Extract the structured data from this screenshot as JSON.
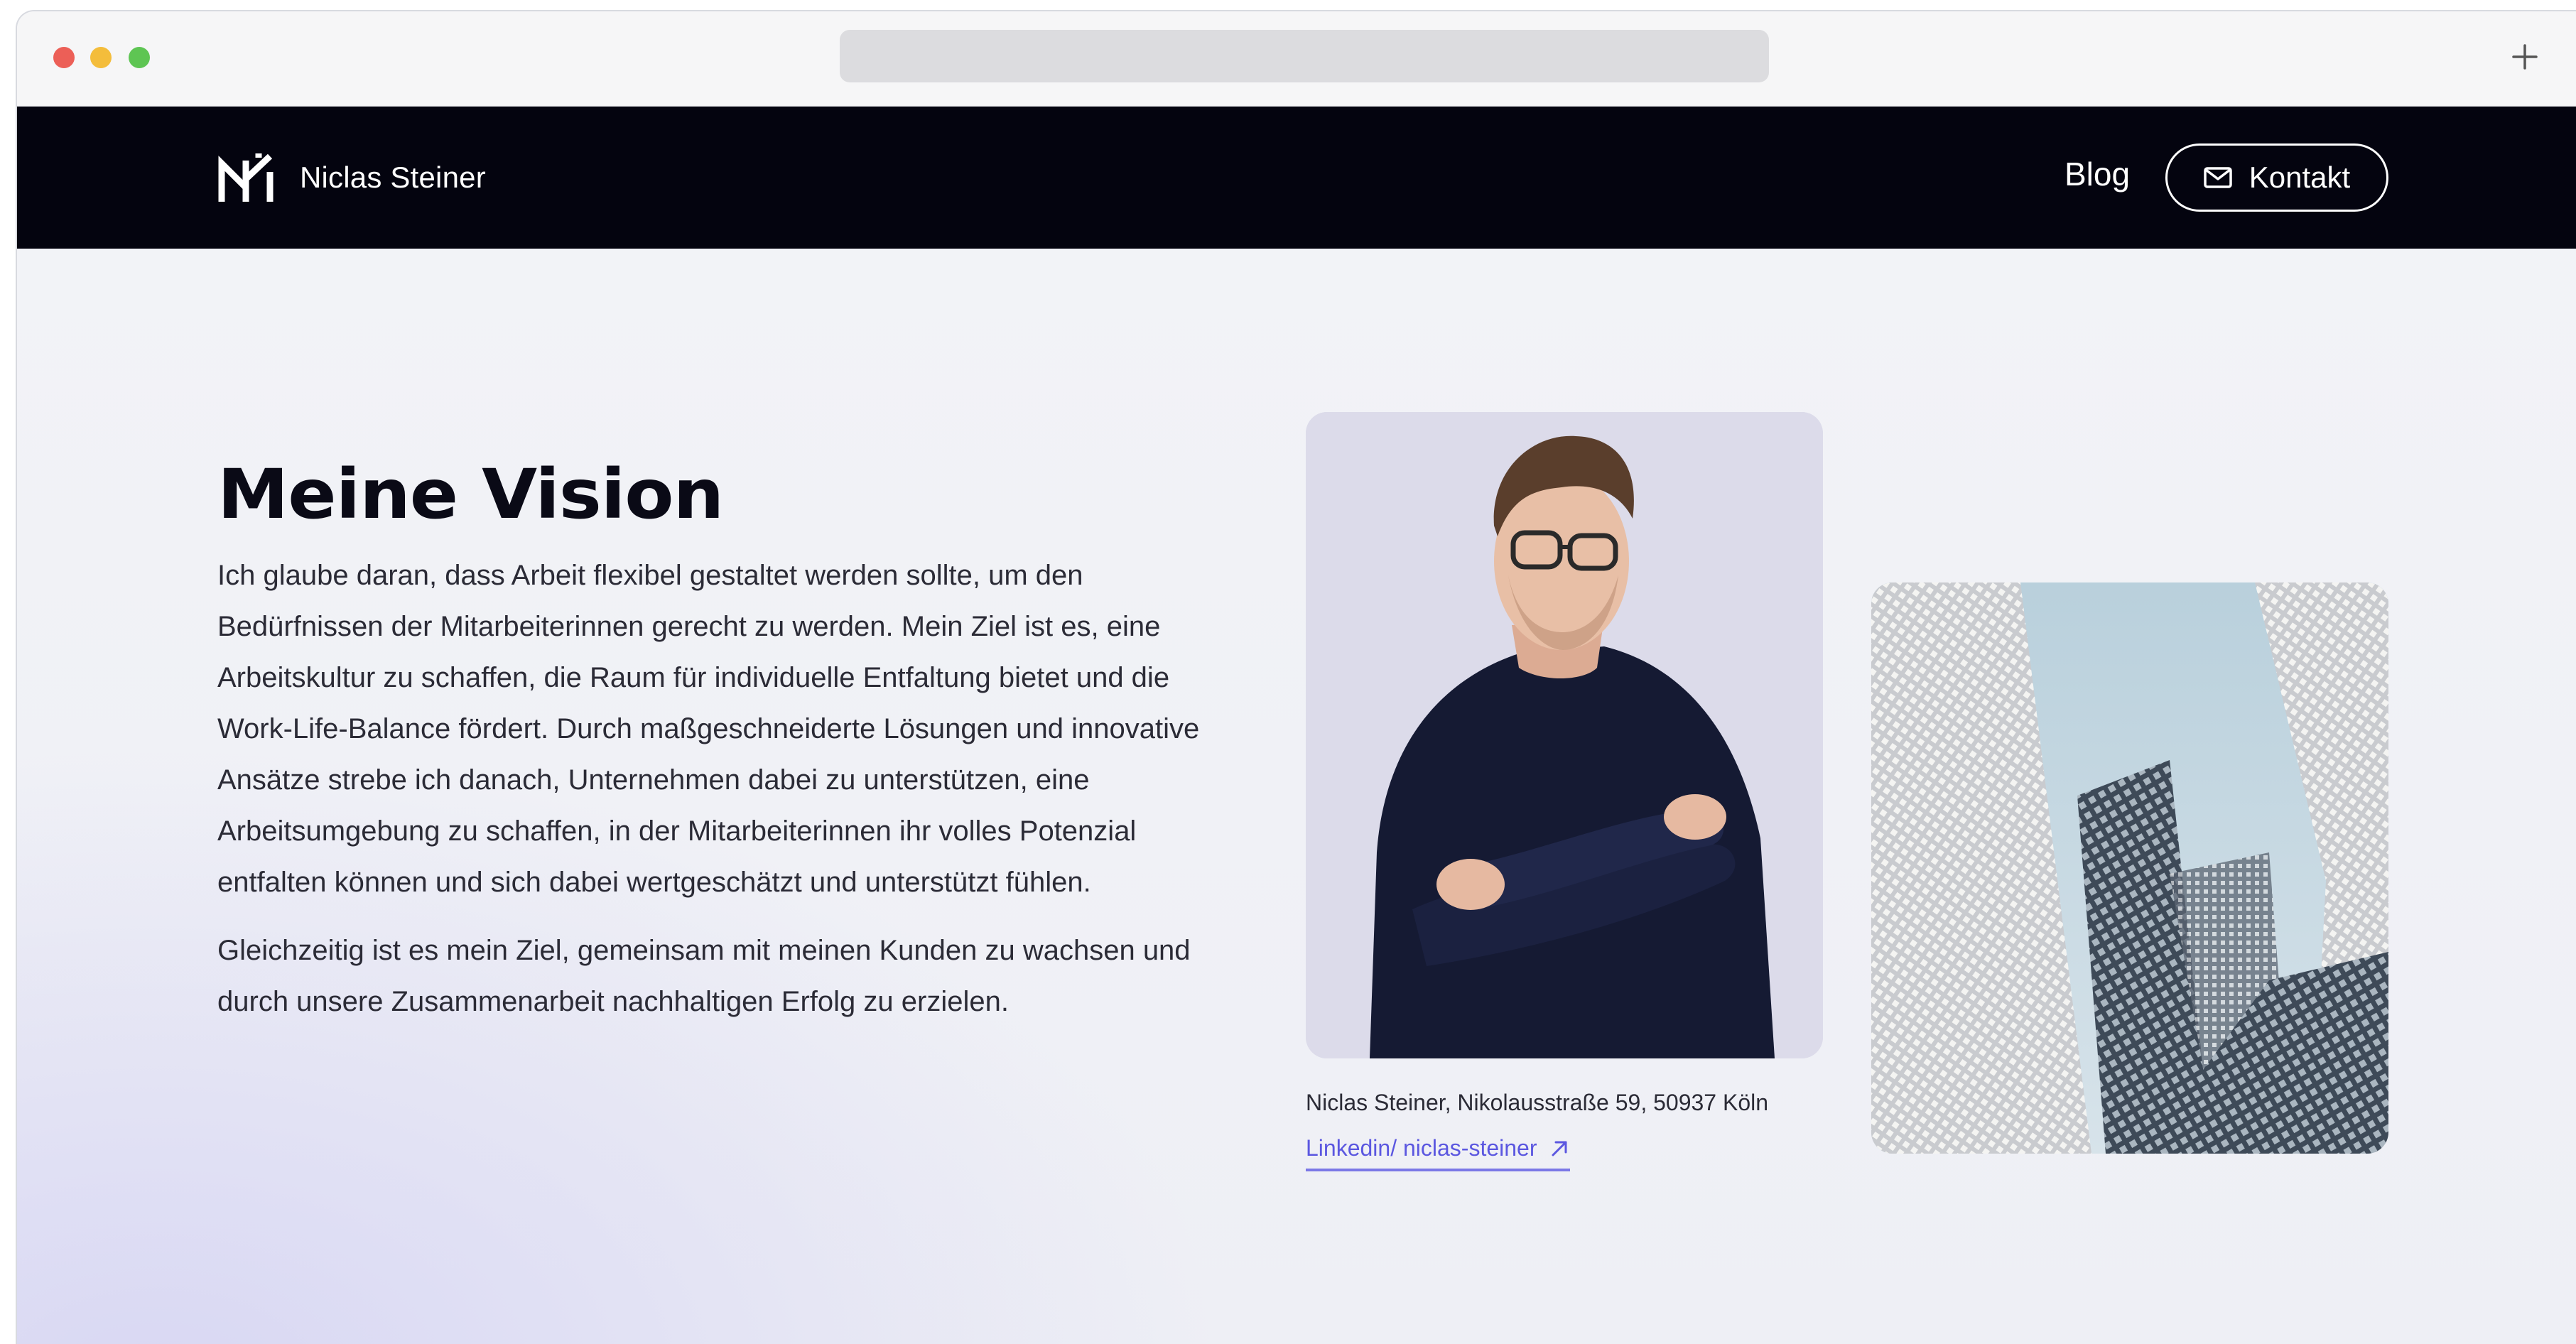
{
  "browser": {
    "new_tab_icon": "plus-icon"
  },
  "header": {
    "logo_name": "Niclas Steiner",
    "nav": {
      "blog_label": "Blog",
      "contact_label": "Kontakt",
      "contact_icon": "mail-icon"
    }
  },
  "main": {
    "title": "Meine Vision",
    "paragraphs": [
      "Ich glaube daran, dass Arbeit flexibel gestaltet werden sollte, um den Bedürfnissen der Mitarbeiterinnen gerecht zu werden. Mein Ziel ist es, eine Arbeitskultur zu schaffen, die Raum für individuelle Entfaltung bietet und die Work-Life-Balance fördert. Durch maßgeschneiderte Lösungen und innovative Ansätze strebe ich danach, Unternehmen dabei zu unterstützen, eine Arbeitsumgebung zu schaffen, in der Mitarbeiterinnen ihr volles Potenzial entfalten können und sich dabei wertgeschätzt und unterstützt fühlen.",
      "Gleichzeitig ist es mein Ziel, gemeinsam mit meinen Kunden zu wachsen und durch unsere Zusammenarbeit nachhaltigen Erfolg zu erzielen."
    ],
    "caption": "Niclas Steiner, Nikolausstraße 59, 50937 Köln",
    "profile_link": "Linkedin/ niclas-steiner",
    "profile_link_icon": "arrow-up-right-icon"
  },
  "colors": {
    "header_bg": "#04040f",
    "accent": "#5b57e0",
    "text": "#2b2b36"
  }
}
